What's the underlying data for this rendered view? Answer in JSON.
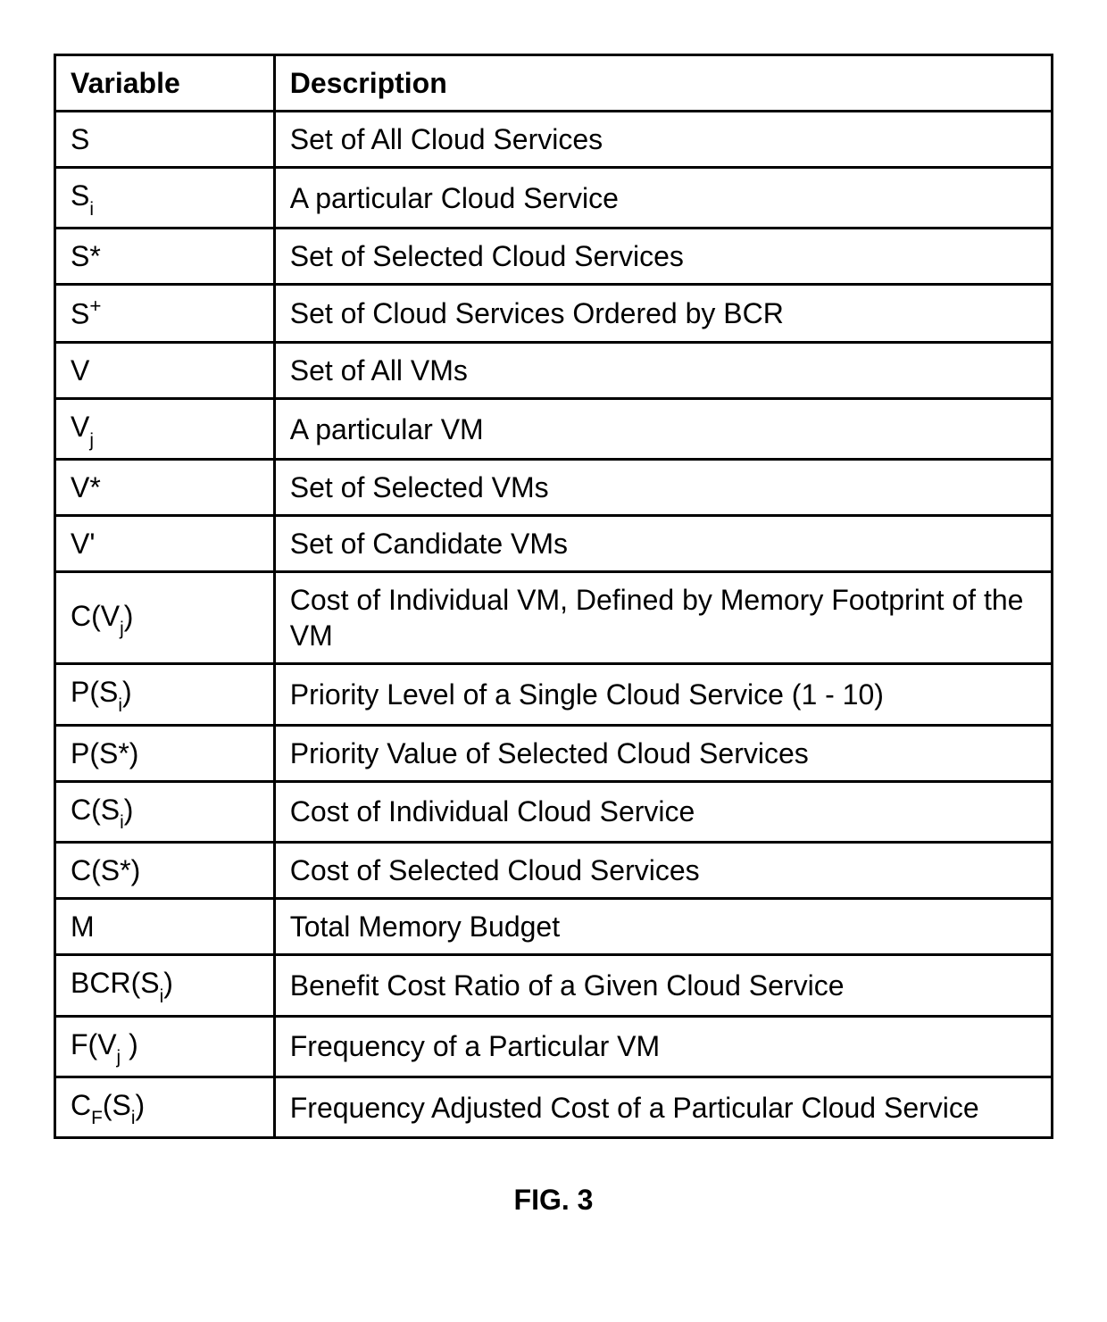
{
  "headers": {
    "variable": "Variable",
    "description": "Description"
  },
  "rows": [
    {
      "var_html": "S",
      "desc": "Set of All Cloud Services"
    },
    {
      "var_html": "S<span class=\"sub\">i</span>",
      "desc": "A particular Cloud Service"
    },
    {
      "var_html": "S*",
      "desc": "Set of Selected Cloud Services"
    },
    {
      "var_html": "S<span class=\"sup\">+</span>",
      "desc": "Set of Cloud Services Ordered by BCR"
    },
    {
      "var_html": "V",
      "desc": "Set of All VMs"
    },
    {
      "var_html": "V<span class=\"sub\">j</span>",
      "desc": "A particular VM"
    },
    {
      "var_html": "V*",
      "desc": "Set of Selected VMs"
    },
    {
      "var_html": "V'",
      "desc": "Set of Candidate VMs"
    },
    {
      "var_html": "C(V<span class=\"sub\">j</span>)",
      "desc": "Cost of Individual VM, Defined by Memory Footprint of the VM"
    },
    {
      "var_html": "P(S<span class=\"sub\">i</span>)",
      "desc": "Priority Level of a Single Cloud Service (1 - 10)"
    },
    {
      "var_html": "P(S*)",
      "desc": "Priority Value of Selected Cloud Services"
    },
    {
      "var_html": "C(S<span class=\"sub\">i</span>)",
      "desc": "Cost of Individual Cloud Service"
    },
    {
      "var_html": "C(S*)",
      "desc": "Cost of Selected Cloud Services"
    },
    {
      "var_html": "M",
      "desc": "Total Memory Budget"
    },
    {
      "var_html": "BCR(S<span class=\"sub\">i</span>)",
      "desc": "Benefit Cost Ratio of a Given Cloud Service"
    },
    {
      "var_html": "F(V<span class=\"sub\">j</span> )",
      "desc": "Frequency of a Particular VM"
    },
    {
      "var_html": "C<span class=\"sub\">F</span>(S<span class=\"sub\">i</span>)",
      "desc": "Frequency Adjusted Cost of a Particular Cloud Service"
    }
  ],
  "caption": "FIG. 3",
  "chart_data": {
    "type": "table",
    "columns": [
      "Variable",
      "Description"
    ],
    "rows": [
      [
        "S",
        "Set of All Cloud Services"
      ],
      [
        "S_i",
        "A particular Cloud Service"
      ],
      [
        "S*",
        "Set of Selected Cloud Services"
      ],
      [
        "S^+",
        "Set of Cloud Services Ordered by BCR"
      ],
      [
        "V",
        "Set of All VMs"
      ],
      [
        "V_j",
        "A particular VM"
      ],
      [
        "V*",
        "Set of Selected VMs"
      ],
      [
        "V'",
        "Set of Candidate VMs"
      ],
      [
        "C(V_j)",
        "Cost of Individual VM, Defined by Memory Footprint of the VM"
      ],
      [
        "P(S_i)",
        "Priority Level of a Single Cloud Service (1 - 10)"
      ],
      [
        "P(S*)",
        "Priority Value of Selected Cloud Services"
      ],
      [
        "C(S_i)",
        "Cost of Individual Cloud Service"
      ],
      [
        "C(S*)",
        "Cost of Selected Cloud Services"
      ],
      [
        "M",
        "Total Memory Budget"
      ],
      [
        "BCR(S_i)",
        "Benefit Cost Ratio of a Given Cloud Service"
      ],
      [
        "F(V_j)",
        "Frequency of a Particular VM"
      ],
      [
        "C_F(S_i)",
        "Frequency Adjusted Cost of a Particular Cloud Service"
      ]
    ]
  }
}
